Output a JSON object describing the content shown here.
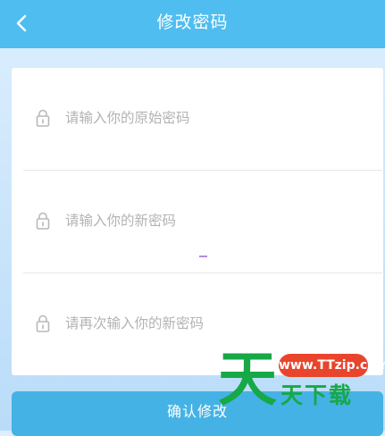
{
  "header": {
    "title": "修改密码",
    "back_icon": "chevron-left-icon",
    "background_color": "#4fbdf0"
  },
  "form": {
    "fields": [
      {
        "placeholder": "请输入你的原始密码",
        "value": "",
        "icon": "lock-icon"
      },
      {
        "placeholder": "请输入你的新密码",
        "value": "",
        "icon": "lock-icon"
      },
      {
        "placeholder": "请再次输入你的新密码",
        "value": "",
        "icon": "lock-icon"
      }
    ]
  },
  "confirm_button": {
    "label": "确认修改",
    "color": "#45b2e6"
  },
  "watermark": {
    "big_char": "天",
    "site": "www.TTzip.com",
    "brand": "天下载",
    "brand_color": "#17a847",
    "pill_color": "#e8452c"
  }
}
